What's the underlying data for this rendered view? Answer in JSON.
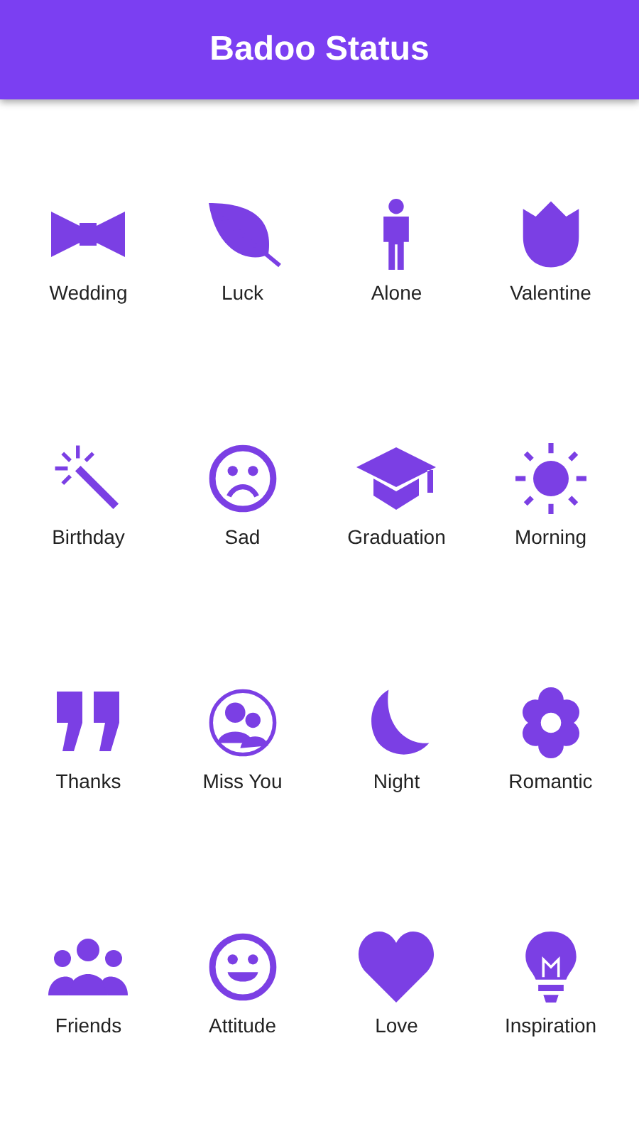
{
  "app_bar": {
    "title": "Badoo Status"
  },
  "statuses": [
    {
      "label": "Wedding",
      "kind": "bowtie"
    },
    {
      "label": "Luck",
      "kind": "leaf"
    },
    {
      "label": "Alone",
      "kind": "person"
    },
    {
      "label": "Valentine",
      "kind": "tulip"
    },
    {
      "label": "Birthday",
      "kind": "wand"
    },
    {
      "label": "Sad",
      "kind": "sad"
    },
    {
      "label": "Graduation",
      "kind": "cap"
    },
    {
      "label": "Morning",
      "kind": "sun"
    },
    {
      "label": "Thanks",
      "kind": "quote"
    },
    {
      "label": "Miss You",
      "kind": "pair"
    },
    {
      "label": "Night",
      "kind": "moon"
    },
    {
      "label": "Romantic",
      "kind": "flower"
    },
    {
      "label": "Friends",
      "kind": "group"
    },
    {
      "label": "Attitude",
      "kind": "smile"
    },
    {
      "label": "Love",
      "kind": "heart"
    },
    {
      "label": "Inspiration",
      "kind": "bulb"
    }
  ]
}
